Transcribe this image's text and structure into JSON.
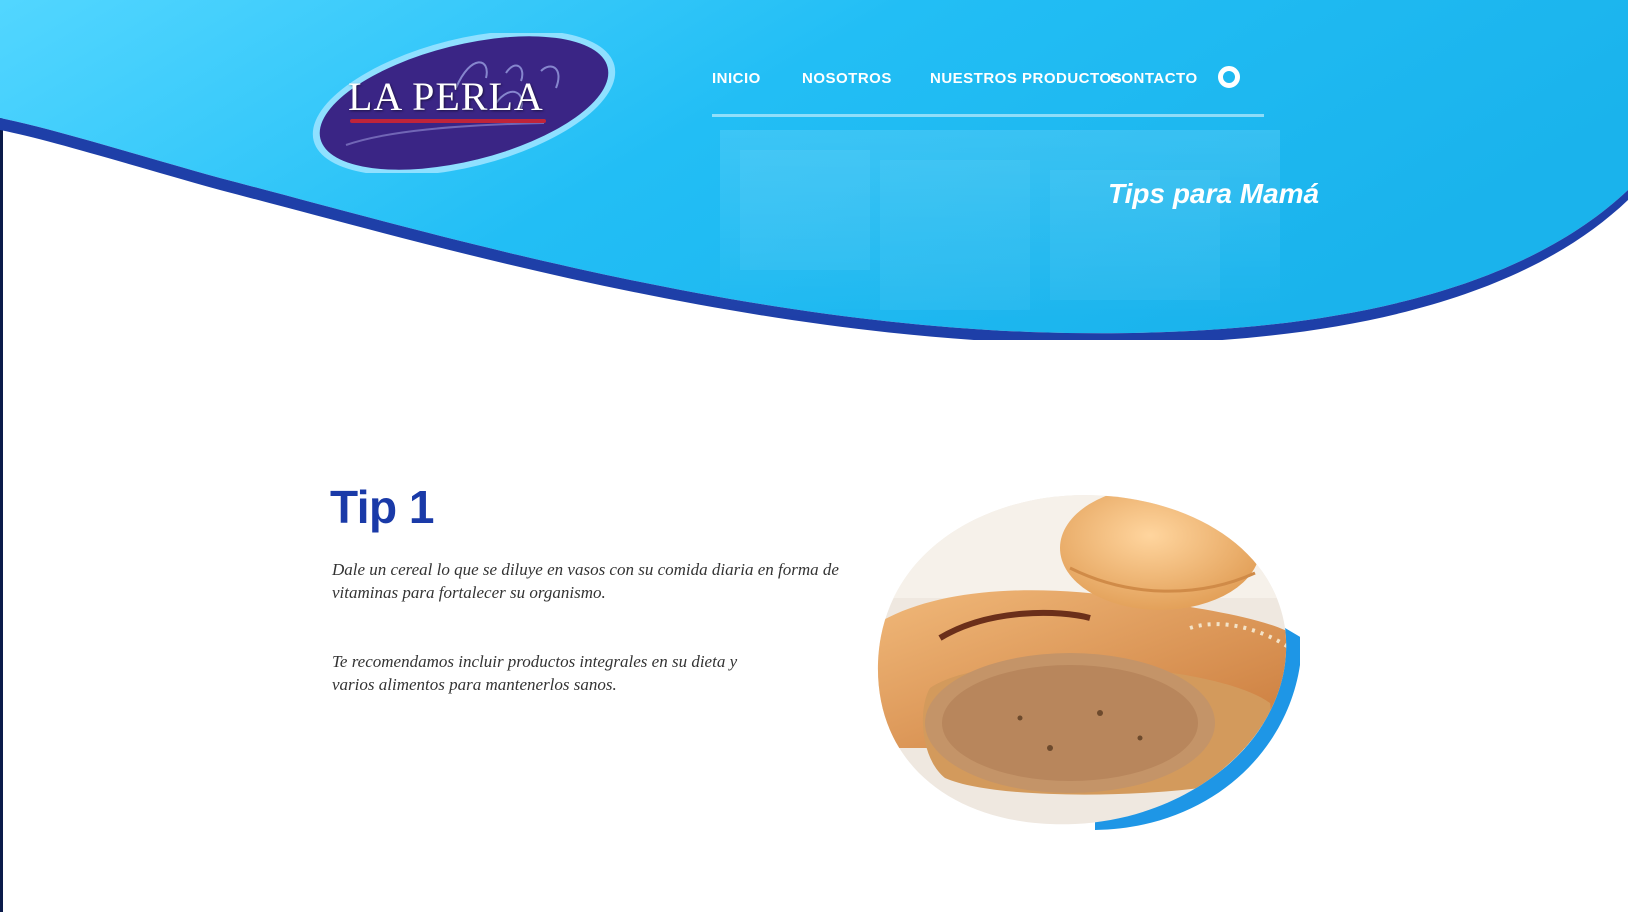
{
  "brand": {
    "logo_text": "LA PERLA"
  },
  "nav": {
    "items": [
      {
        "label": "INICIO"
      },
      {
        "label": "NOSOTROS"
      },
      {
        "label": "NUESTROS PRODUCTOS"
      },
      {
        "label": "CONTACTO"
      }
    ],
    "search_icon": "search-icon"
  },
  "hero": {
    "title": "Tips para Mamá"
  },
  "tip": {
    "title": "Tip 1",
    "paragraphs": [
      "Dale un cereal lo que se diluye en vasos con su comida diaria en forma de vitaminas para fortalecer su organismo.",
      "Te recomendamos incluir productos integrales en su dieta y varios alimentos para mantenerlos sanos."
    ],
    "image_icon": "bread-image"
  },
  "colors": {
    "header_light": "#4fd0ff",
    "header_mid": "#1db8f4",
    "header_dark": "#1e3fa8",
    "title_blue": "#1a3aa8",
    "logo_purple": "#3a2585",
    "logo_red": "#c0243a"
  }
}
